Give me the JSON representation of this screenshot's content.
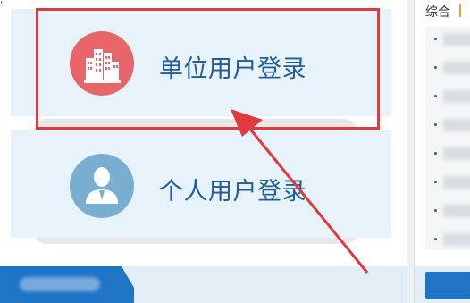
{
  "login": {
    "unit_label": "单位用户登录",
    "person_label": "个人用户登录",
    "icons": {
      "unit": "building-icon",
      "person": "user-icon"
    }
  },
  "right_panel": {
    "tab_label": "综合"
  },
  "colors": {
    "highlight": "#e0393e",
    "unit_icon_bg": "#e8656a",
    "person_icon_bg": "#79aed0",
    "label": "#1e5e9a",
    "tab_blue": "#1f74c6"
  }
}
